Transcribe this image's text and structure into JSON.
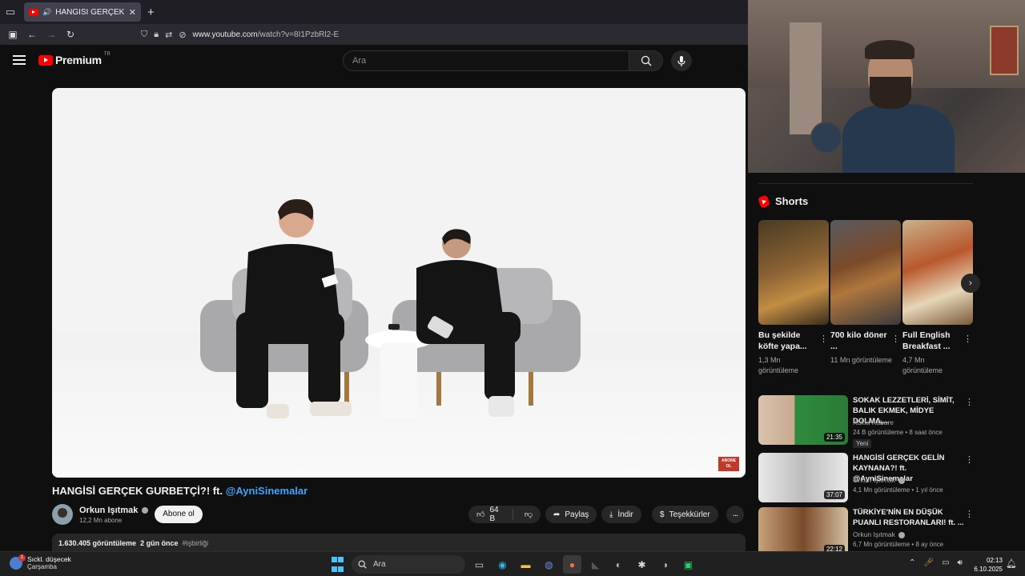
{
  "browser": {
    "tab_title": "HANGİSİ GERÇEK GURBETÇ",
    "url_domain": "www.youtube.com",
    "url_path": "/watch?v=8I1PzbRl2-E"
  },
  "youtube": {
    "logo_text": "Premium",
    "logo_region": "TR",
    "search_placeholder": "Ara"
  },
  "video": {
    "title_main": "HANGİSİ GERÇEK GURBETÇİ?! ft.",
    "title_mention": "@AyniSinemalar",
    "badge_text": "ABONE OL"
  },
  "channel": {
    "name": "Orkun Işıtmak",
    "subs": "12,2 Mn abone",
    "subscribe_label": "Abone ol"
  },
  "actions": {
    "likes": "64 B",
    "share": "Paylaş",
    "download": "İndir",
    "thanks": "Teşekkürler",
    "more": "..."
  },
  "description": {
    "views": "1.630.405 görüntüleme",
    "date": "2 gün önce",
    "tag": "#işbirliği"
  },
  "shorts": {
    "heading": "Shorts",
    "items": [
      {
        "title": "Bu şekilde köfte yapa...",
        "views": "1,3 Mn görüntüleme"
      },
      {
        "title": "700 kilo döner ...",
        "views": "11 Mn görüntüleme"
      },
      {
        "title": "Full English Breakfast ...",
        "views": "4,7 Mn görüntüleme"
      }
    ]
  },
  "recommended": [
    {
      "title": "SOKAK LEZZETLERİ, SİMİT, BALIK EKMEK, MİDYE DOLMA,...",
      "channel": "Kukla Kabare",
      "meta": "24 B görüntüleme • 8 saat önce",
      "duration": "21:35",
      "badge": "Yeni"
    },
    {
      "title": "HANGİSİ GERÇEK GELİN KAYNANA?! ft. @AyniSinemalar",
      "channel": "Orkun Işıtmak",
      "meta": "4,1 Mn görüntüleme • 1 yıl önce",
      "duration": "37:07"
    },
    {
      "title": "TÜRKİYE'NİN EN DÜŞÜK PUANLI RESTORANLARI! ft. ...",
      "channel": "Orkun Işıtmak",
      "meta": "6,7 Mn görüntüleme • 8 ay önce",
      "duration": "22:12"
    }
  ],
  "taskbar": {
    "weather_line1": "Sıckl. düşecek",
    "weather_line2": "Çarşamba",
    "search_label": "Ara",
    "time": "02:13",
    "date": "6.10.2025"
  }
}
